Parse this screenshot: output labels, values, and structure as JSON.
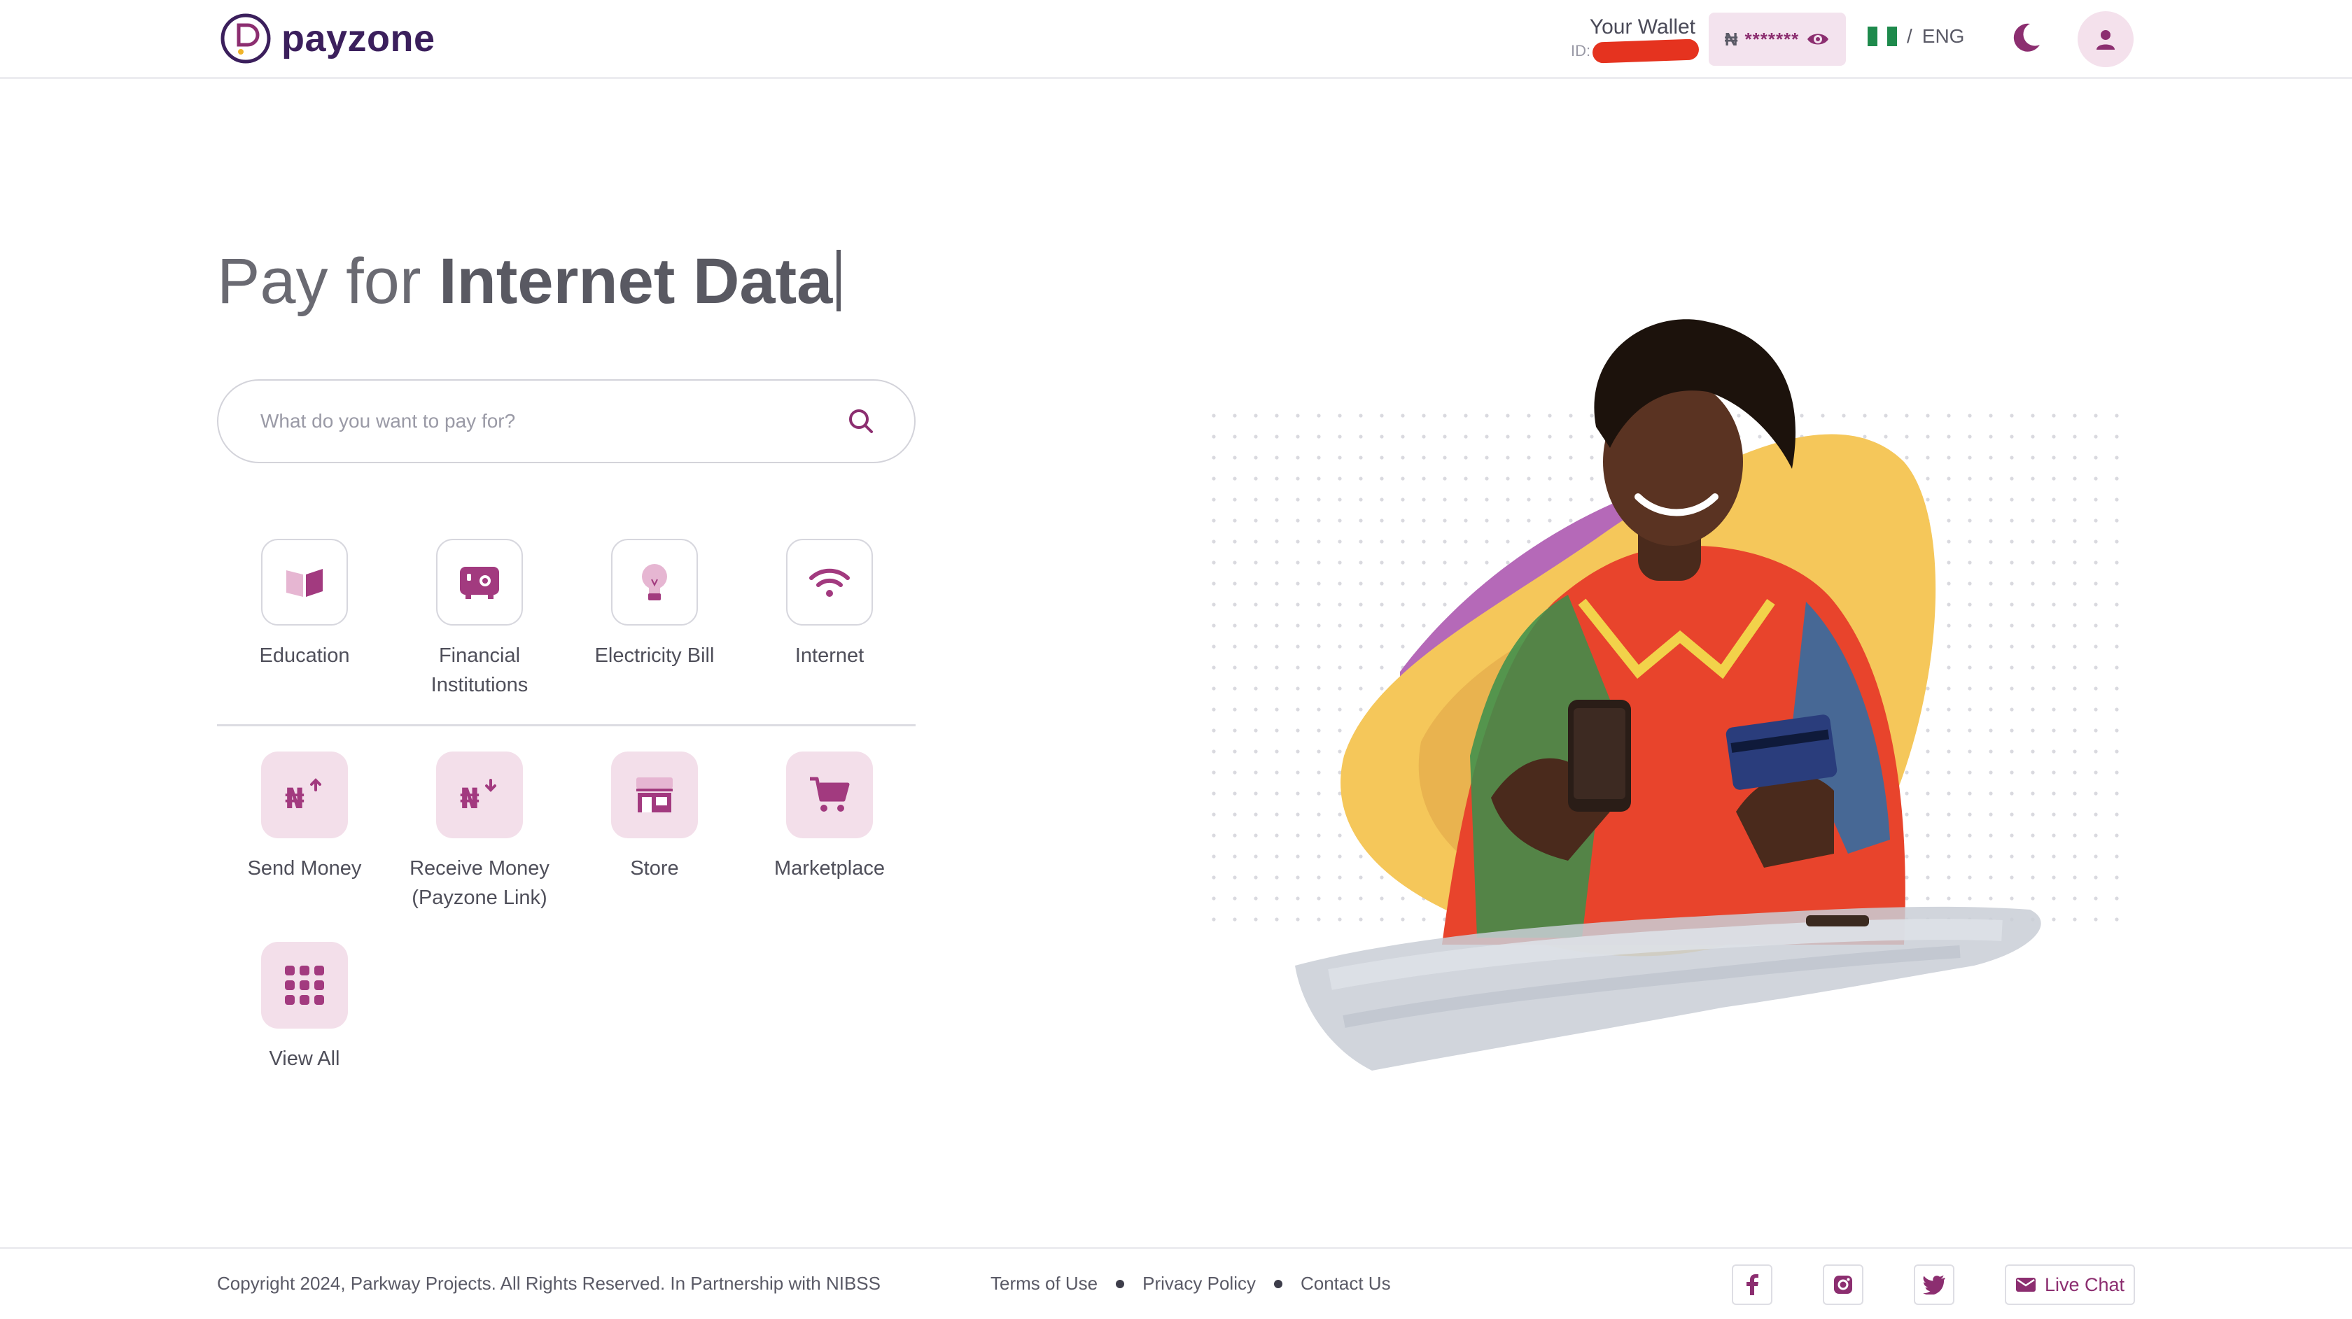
{
  "header": {
    "brand": "payzone",
    "wallet_title": "Your Wallet",
    "wallet_id_label": "ID:",
    "balance_currency": "₦",
    "balance_masked": "*******",
    "language": "ENG",
    "lang_separator": "/"
  },
  "hero": {
    "title_prefix": "Pay for",
    "title_highlight": "Internet Data"
  },
  "search": {
    "placeholder": "What do you want to pay for?"
  },
  "categories": [
    {
      "label": "Education",
      "icon": "book-icon"
    },
    {
      "label": "Financial Institutions",
      "icon": "safe-icon"
    },
    {
      "label": "Electricity Bill",
      "icon": "lightbulb-icon"
    },
    {
      "label": "Internet",
      "icon": "wifi-icon"
    }
  ],
  "services": [
    {
      "label": "Send Money",
      "icon": "naira-send-icon"
    },
    {
      "label": "Receive Money (Payzone Link)",
      "icon": "naira-receive-icon"
    },
    {
      "label": "Store",
      "icon": "store-icon"
    },
    {
      "label": "Marketplace",
      "icon": "cart-icon"
    },
    {
      "label": "View All",
      "icon": "grid-icon"
    }
  ],
  "footer": {
    "copyright": "Copyright 2024, Parkway Projects. All Rights Reserved. In Partnership with NIBSS",
    "links": [
      "Terms of Use",
      "Privacy Policy",
      "Contact Us"
    ],
    "social": [
      "facebook-icon",
      "instagram-icon",
      "twitter-icon"
    ],
    "live_chat": "Live Chat"
  },
  "colors": {
    "brand": "#3b1f5c",
    "accent": "#8c2e70",
    "accent_soft": "#f3dfea",
    "blob_yellow": "#f5c75a",
    "blob_purple": "#b569b8"
  }
}
